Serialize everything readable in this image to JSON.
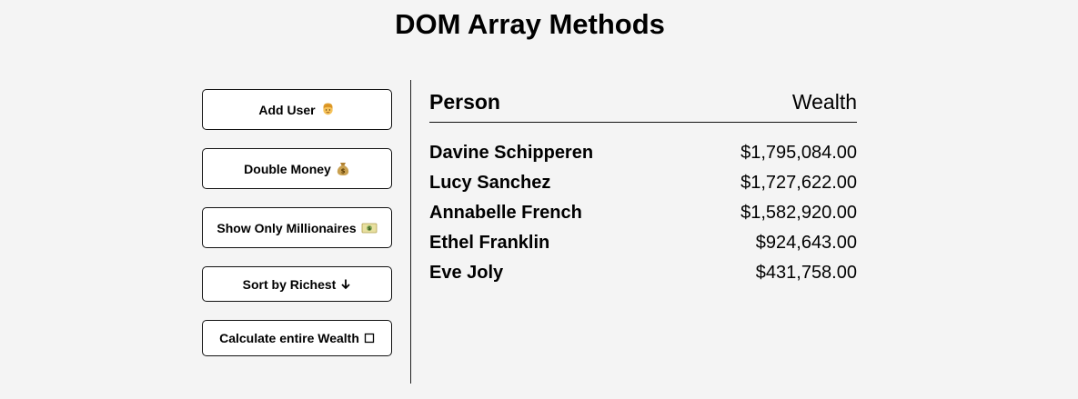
{
  "page": {
    "title": "DOM Array Methods"
  },
  "actions": [
    {
      "label": "Add User",
      "icon": "person-icon"
    },
    {
      "label": "Double Money",
      "icon": "money-bag-icon"
    },
    {
      "label": "Show Only Millionaires",
      "icon": "dollar-bill-icon"
    },
    {
      "label": "Sort by Richest",
      "icon": "arrow-down-icon"
    },
    {
      "label": "Calculate entire Wealth",
      "icon": "empty-box-icon"
    }
  ],
  "table": {
    "headers": {
      "person": "Person",
      "wealth": "Wealth"
    },
    "rows": [
      {
        "name": "Davine Schipperen",
        "wealth": "$1,795,084.00"
      },
      {
        "name": "Lucy Sanchez",
        "wealth": "$1,727,622.00"
      },
      {
        "name": "Annabelle French",
        "wealth": "$1,582,920.00"
      },
      {
        "name": "Ethel Franklin",
        "wealth": "$924,643.00"
      },
      {
        "name": "Eve Joly",
        "wealth": "$431,758.00"
      }
    ]
  }
}
